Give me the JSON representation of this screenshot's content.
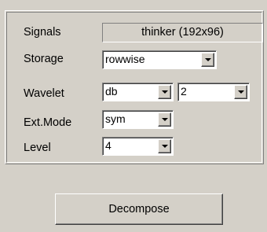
{
  "panel": {
    "signals_label": "Signals",
    "signals_value": "thinker (192x96)",
    "storage_label": "Storage",
    "storage_value": "rowwise",
    "wavelet_label": "Wavelet",
    "wavelet_family": "db",
    "wavelet_order": "2",
    "extmode_label": "Ext.Mode",
    "extmode_value": "sym",
    "level_label": "Level",
    "level_value": "4"
  },
  "actions": {
    "decompose_label": "Decompose"
  },
  "icons": {
    "dropdown": "chevron-down-icon"
  }
}
